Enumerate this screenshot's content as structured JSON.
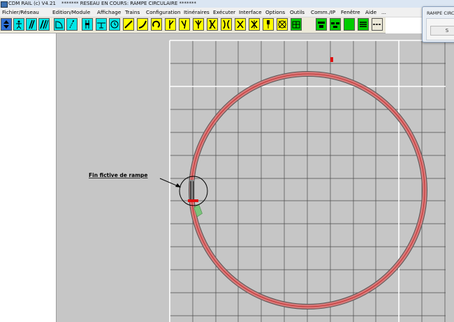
{
  "window": {
    "app_title": "CDM RAIL (c) V4.21",
    "document_title": "******* RESEAU EN COURS: RAMPE CIRCULAIRE *******"
  },
  "menu": {
    "items": [
      "Fichier/Réseau",
      "Edition/Module",
      "Affichage",
      "Trains",
      "Configuration",
      "Itinéraires",
      "Exécuter",
      "Interface",
      "Options",
      "Outils",
      "Comm./IP",
      "Fenêtre",
      "Aide",
      "..."
    ]
  },
  "toolbar": {
    "buttons": [
      {
        "icon": "select-arrows-icon",
        "color": "#2e6fd6"
      },
      {
        "icon": "person-icon",
        "color": "#00e6e6"
      },
      {
        "icon": "slanted-bars-icon",
        "color": "#00e6e6"
      },
      {
        "icon": "double-slash-icon",
        "color": "#00e6e6"
      },
      {
        "icon": "curve-corner-icon",
        "color": "#00e6e6"
      },
      {
        "icon": "dotted-line-icon",
        "color": "#00e6e6"
      },
      {
        "icon": "vertical-signal-icon",
        "color": "#00e6e6"
      },
      {
        "icon": "horizontal-block-icon",
        "color": "#00e6e6"
      },
      {
        "icon": "clock-icon",
        "color": "#00e6e6"
      },
      {
        "icon": "straight-track-icon",
        "color": "#ffff00"
      },
      {
        "icon": "curved-track-icon",
        "color": "#ffff00"
      },
      {
        "icon": "loop-track-icon",
        "color": "#ffff00"
      },
      {
        "icon": "turnout-right-icon",
        "color": "#ffff00"
      },
      {
        "icon": "turnout-left-icon",
        "color": "#ffff00"
      },
      {
        "icon": "three-way-turnout-icon",
        "color": "#ffff00"
      },
      {
        "icon": "double-slip-icon",
        "color": "#ffff00"
      },
      {
        "icon": "crossing-icon",
        "color": "#ffff00"
      },
      {
        "icon": "diamond-crossing-icon",
        "color": "#ffff00"
      },
      {
        "icon": "turntable-icon",
        "color": "#ffff00"
      },
      {
        "icon": "signal-icon",
        "color": "#ffff00"
      },
      {
        "icon": "building-icon",
        "color": "#ffff00"
      },
      {
        "icon": "green-module-1-icon",
        "color": "#00cc00"
      },
      {
        "icon": "green-module-2-icon",
        "color": "#00cc00"
      },
      {
        "icon": "green-square-icon",
        "color": "#00cc00"
      },
      {
        "icon": "green-bars-icon",
        "color": "#00cc00"
      },
      {
        "icon": "green-dashes-icon",
        "color": "#00cc00"
      }
    ]
  },
  "floating_window": {
    "title": "RAMPE CIRCULAIRE",
    "button_label": "S"
  },
  "canvas": {
    "annotation_label": "Fin  fictive  de  rampe",
    "colors": {
      "background": "#c6c6c6",
      "grid_lines": "#4a4a4a",
      "module_border": "#ffffff",
      "track_fill": "#d77a7a",
      "track_border": "#555555",
      "rail_line": "#c02020",
      "ramp_end_marker": "#e01010",
      "green_section": "#7bc47b"
    }
  }
}
